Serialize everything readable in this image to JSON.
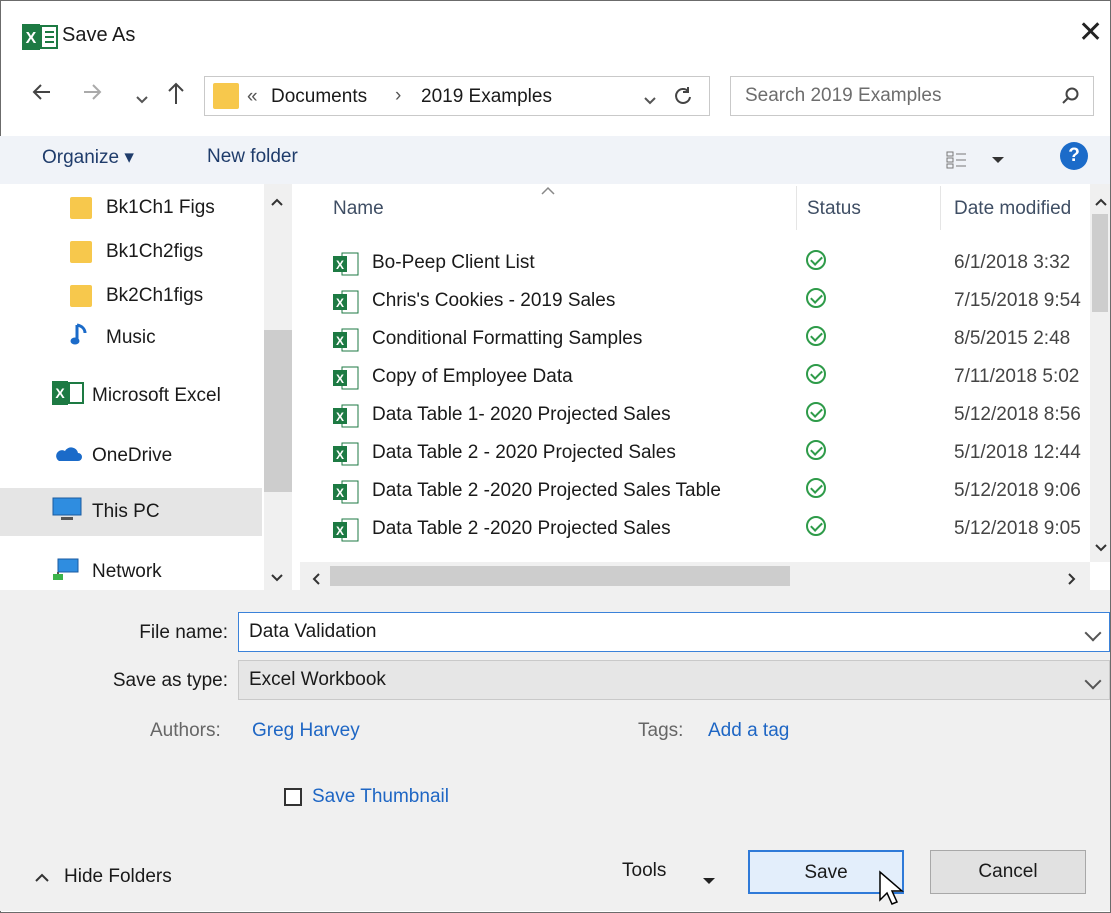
{
  "window": {
    "title": "Save As",
    "close_icon": "close-icon",
    "app_icon": "excel-icon"
  },
  "nav": {
    "back_icon": "arrow-left-icon",
    "forward_icon": "arrow-right-icon",
    "recent_icon": "chevron-down-icon",
    "up_icon": "arrow-up-icon",
    "breadcrumb_overflow": "«",
    "breadcrumb": [
      "Documents",
      "2019 Examples"
    ],
    "breadcrumb_sep": "›",
    "refresh_icon": "refresh-icon",
    "search_placeholder": "Search 2019 Examples"
  },
  "toolbar": {
    "organize_label": "Organize ▾",
    "new_folder_label": "New folder",
    "help_label": "?"
  },
  "sidebar": {
    "items": [
      {
        "label": "Bk1Ch1 Figs",
        "icon": "folder-icon"
      },
      {
        "label": "Bk1Ch2figs",
        "icon": "folder-icon"
      },
      {
        "label": "Bk2Ch1figs",
        "icon": "folder-icon"
      },
      {
        "label": "Music",
        "icon": "music-icon"
      },
      {
        "label": "Microsoft Excel",
        "icon": "excel-icon"
      },
      {
        "label": "OneDrive",
        "icon": "cloud-icon"
      },
      {
        "label": "This PC",
        "icon": "computer-icon",
        "selected": true
      },
      {
        "label": "Network",
        "icon": "network-icon"
      }
    ]
  },
  "files": {
    "headers": {
      "name": "Name",
      "status": "Status",
      "date": "Date modified"
    },
    "rows": [
      {
        "name": "Bo-Peep Client List",
        "date": "6/1/2018 3:32"
      },
      {
        "name": "Chris's Cookies - 2019 Sales",
        "date": "7/15/2018 9:54"
      },
      {
        "name": "Conditional Formatting Samples",
        "date": "8/5/2015 2:48"
      },
      {
        "name": "Copy of Employee Data",
        "date": "7/11/2018 5:02"
      },
      {
        "name": "Data Table 1- 2020 Projected Sales",
        "date": "5/12/2018 8:56"
      },
      {
        "name": "Data Table 2 - 2020 Projected Sales",
        "date": "5/1/2018 12:44"
      },
      {
        "name": "Data Table 2 -2020 Projected Sales Table",
        "date": "5/12/2018 9:06"
      },
      {
        "name": "Data Table 2 -2020 Projected Sales",
        "date": "5/12/2018 9:05"
      }
    ]
  },
  "form": {
    "file_name_label": "File name:",
    "file_name_value": "Data Validation",
    "save_type_label": "Save as type:",
    "save_type_value": "Excel Workbook",
    "authors_label": "Authors:",
    "authors_value": "Greg Harvey",
    "tags_label": "Tags:",
    "tags_value": "Add a tag",
    "thumbnail_label": "Save Thumbnail"
  },
  "footer": {
    "hide_folders_label": "Hide Folders",
    "tools_label": "Tools",
    "save_label": "Save",
    "cancel_label": "Cancel"
  }
}
